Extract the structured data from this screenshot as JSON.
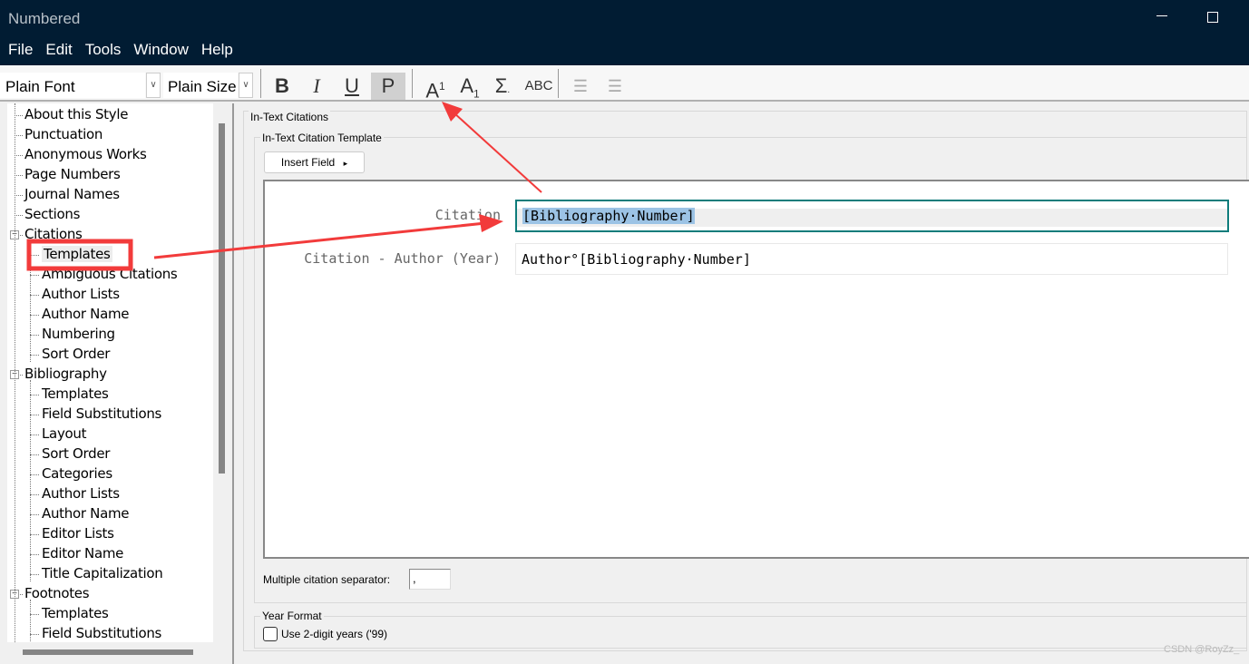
{
  "window": {
    "title": "Numbered",
    "minimize_icon": "minimize-icon",
    "maximize_icon": "maximize-icon"
  },
  "menu": [
    "File",
    "Edit",
    "Tools",
    "Window",
    "Help"
  ],
  "toolbar": {
    "font": "Plain Font",
    "size": "Plain Size",
    "bold": "B",
    "italic": "I",
    "underline": "U",
    "plain": "P",
    "superscript": "A",
    "superscript_mark": "1",
    "subscript": "A",
    "subscript_mark": "1",
    "symbol": "Σ",
    "symbol_mark": ".",
    "smallcaps": "ABC",
    "align_left_icon": "align-left-icon",
    "align_center_icon": "align-center-icon"
  },
  "tree": [
    {
      "label": "About this Style",
      "level": 0
    },
    {
      "label": "Punctuation",
      "level": 0
    },
    {
      "label": "Anonymous Works",
      "level": 0
    },
    {
      "label": "Page Numbers",
      "level": 0
    },
    {
      "label": "Journal Names",
      "level": 0
    },
    {
      "label": "Sections",
      "level": 0
    },
    {
      "label": "Citations",
      "level": 0,
      "expanded": true
    },
    {
      "label": "Templates",
      "level": 1,
      "selected": true
    },
    {
      "label": "Ambiguous Citations",
      "level": 1
    },
    {
      "label": "Author Lists",
      "level": 1
    },
    {
      "label": "Author Name",
      "level": 1
    },
    {
      "label": "Numbering",
      "level": 1
    },
    {
      "label": "Sort Order",
      "level": 1
    },
    {
      "label": "Bibliography",
      "level": 0,
      "expanded": true
    },
    {
      "label": "Templates",
      "level": 1
    },
    {
      "label": "Field Substitutions",
      "level": 1
    },
    {
      "label": "Layout",
      "level": 1
    },
    {
      "label": "Sort Order",
      "level": 1
    },
    {
      "label": "Categories",
      "level": 1
    },
    {
      "label": "Author Lists",
      "level": 1
    },
    {
      "label": "Author Name",
      "level": 1
    },
    {
      "label": "Editor Lists",
      "level": 1
    },
    {
      "label": "Editor Name",
      "level": 1
    },
    {
      "label": "Title Capitalization",
      "level": 1
    },
    {
      "label": "Footnotes",
      "level": 0,
      "expanded": true
    },
    {
      "label": "Templates",
      "level": 1
    },
    {
      "label": "Field Substitutions",
      "level": 1
    }
  ],
  "main": {
    "group_title": "In-Text Citations",
    "template_group": "In-Text Citation Template",
    "insert_field": "Insert Field",
    "insert_arrow": "▸",
    "citation_label": "Citation",
    "citation_value": "[Bibliography·Number]",
    "author_year_label": "Citation - Author (Year)",
    "author_year_value": "Author°[Bibliography·Number]",
    "separator_label": "Multiple citation separator:",
    "separator_value": ",",
    "year_group": "Year Format",
    "two_digit_label": "Use 2-digit years ('99)",
    "two_digit_checked": false
  },
  "annotation_color": "#f23b3b",
  "watermark": "CSDN @RoyZz_"
}
